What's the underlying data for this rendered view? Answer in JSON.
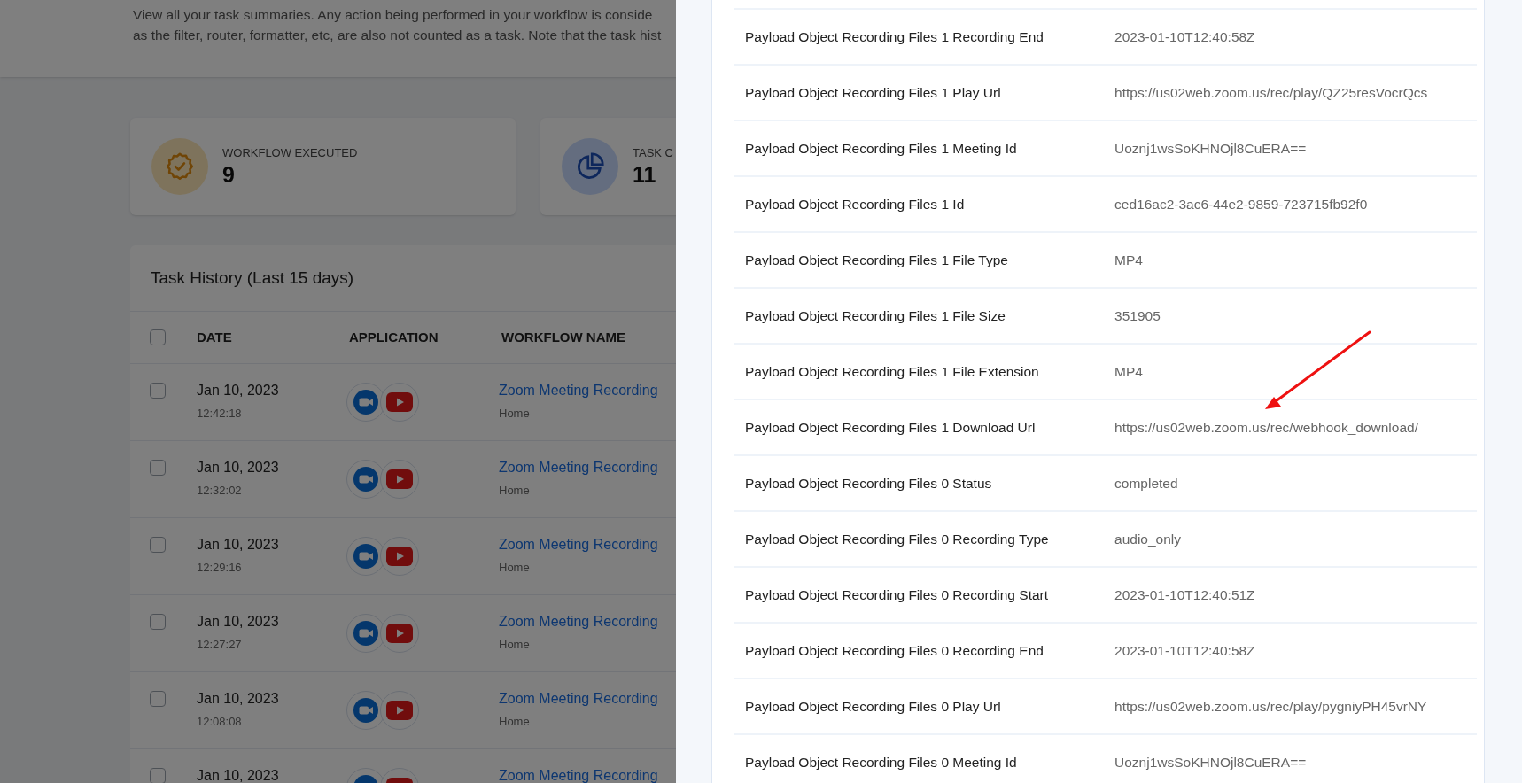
{
  "intro": [
    "View all your task summaries. Any action being performed in your workflow is conside",
    "as the filter, router, formatter, etc, are also not counted as a task. Note that the task hist"
  ],
  "stats": [
    {
      "kind": "workflows",
      "label": "WORKFLOW EXECUTED",
      "value": "9"
    },
    {
      "kind": "tasks",
      "label": "TASK C",
      "value": "11"
    }
  ],
  "task_history": {
    "title": "Task History (Last 15 days)",
    "columns": [
      "DATE",
      "APPLICATION",
      "WORKFLOW NAME"
    ],
    "all_checked": false,
    "rows": [
      {
        "checked": false,
        "date": "Jan 10, 2023",
        "time": "12:42:18",
        "workflow": "Zoom Meeting Recording",
        "folder": "Home"
      },
      {
        "checked": false,
        "date": "Jan 10, 2023",
        "time": "12:32:02",
        "workflow": "Zoom Meeting Recording",
        "folder": "Home"
      },
      {
        "checked": false,
        "date": "Jan 10, 2023",
        "time": "12:29:16",
        "workflow": "Zoom Meeting Recording",
        "folder": "Home"
      },
      {
        "checked": false,
        "date": "Jan 10, 2023",
        "time": "12:27:27",
        "workflow": "Zoom Meeting Recording",
        "folder": "Home"
      },
      {
        "checked": false,
        "date": "Jan 10, 2023",
        "time": "12:08:08",
        "workflow": "Zoom Meeting Recording",
        "folder": "Home"
      },
      {
        "checked": false,
        "date": "Jan 10, 2023",
        "workflow": "Zoom Meeting Recording"
      }
    ]
  },
  "details": [
    {
      "key": "Payload Object Recording Files 1 Recording End",
      "value": "2023-01-10T12:40:58Z"
    },
    {
      "key": "Payload Object Recording Files 1 Play Url",
      "value": "https://us02web.zoom.us/rec/play/QZ25resVocrQcs"
    },
    {
      "key": "Payload Object Recording Files 1 Meeting Id",
      "value": "Uoznj1wsSoKHNOjl8CuERA=="
    },
    {
      "key": "Payload Object Recording Files 1 Id",
      "value": "ced16ac2-3ac6-44e2-9859-723715fb92f0"
    },
    {
      "key": "Payload Object Recording Files 1 File Type",
      "value": "MP4"
    },
    {
      "key": "Payload Object Recording Files 1 File Size",
      "value": "351905"
    },
    {
      "key": "Payload Object Recording Files 1 File Extension",
      "value": "MP4"
    },
    {
      "key": "Payload Object Recording Files 1 Download Url",
      "value": "https://us02web.zoom.us/rec/webhook_download/"
    },
    {
      "key": "Payload Object Recording Files 0 Status",
      "value": "completed"
    },
    {
      "key": "Payload Object Recording Files 0 Recording Type",
      "value": "audio_only"
    },
    {
      "key": "Payload Object Recording Files 0 Recording Start",
      "value": "2023-01-10T12:40:51Z"
    },
    {
      "key": "Payload Object Recording Files 0 Recording End",
      "value": "2023-01-10T12:40:58Z"
    },
    {
      "key": "Payload Object Recording Files 0 Play Url",
      "value": "https://us02web.zoom.us/rec/play/pygniyPH45vrNY"
    },
    {
      "key": "Payload Object Recording Files 0 Meeting Id",
      "value": "Uoznj1wsSoKHNOjl8CuERA=="
    }
  ]
}
